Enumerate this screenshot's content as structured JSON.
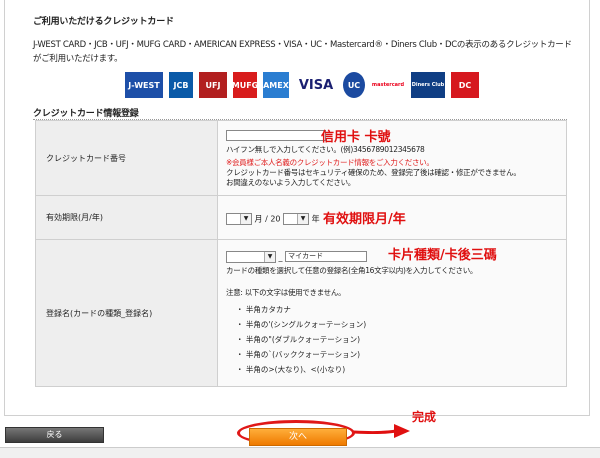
{
  "cards_section": {
    "title": "ご利用いただけるクレジットカード",
    "description": "J-WEST CARD・JCB・UFJ・MUFG CARD・AMERICAN EXPRESS・VISA・UC・Mastercard®・Diners Club・DCの表示のあるクレジットカードがご利用いただけます。",
    "logos": [
      {
        "icon": "jwest-card-logo",
        "text": "J-WEST",
        "color": "#1d4fa8"
      },
      {
        "icon": "jcb-logo",
        "text": "JCB",
        "color": "#0a5aa8"
      },
      {
        "icon": "ufj-card-logo",
        "text": "UFJ",
        "color": "#b21f1f"
      },
      {
        "icon": "mufg-card-logo",
        "text": "MUFG",
        "color": "#d81c1c"
      },
      {
        "icon": "amex-logo",
        "text": "AMEX",
        "color": "#2a7dd1"
      },
      {
        "icon": "visa-logo",
        "text": "VISA",
        "color": "#1a1f71"
      },
      {
        "icon": "uc-logo",
        "text": "UC",
        "color": "#1b4aa0"
      },
      {
        "icon": "mastercard-logo",
        "text": "mastercard",
        "color": "#eb001b"
      },
      {
        "icon": "diners-club-logo",
        "text": "Diners Club",
        "color": "#0f3e84"
      },
      {
        "icon": "dc-card-logo",
        "text": "DC",
        "color": "#d6181f"
      }
    ]
  },
  "registration": {
    "title": "クレジットカード情報登録",
    "card_number": {
      "label": "クレジットカード番号",
      "value": "",
      "hint": "ハイフン無しで入力してください。(例)3456789012345678",
      "warning": "※会員様ご本人名義のクレジットカード情報をご入力ください。",
      "note1": "クレジットカード番号はセキュリティ確保のため、登録完了後は確認・修正ができません。",
      "note2": "お間違えのないよう入力してください。",
      "annotation": "信用卡 卡號"
    },
    "expiry": {
      "label": "有効期限(月/年)",
      "month_value": "",
      "month_unit": "月",
      "sep": "/",
      "year_prefix": "20",
      "year_value": "",
      "year_unit": "年",
      "annotation": "有效期限月/年"
    },
    "reg_name": {
      "label": "登録名(カードの種類_登録名)",
      "type_value": "",
      "underscore": "_",
      "name_value": "マイカード",
      "hint": "カードの種類を選択して任意の登録名(全角16文字以内)を入力してください。",
      "notice_title": "注意: 以下の文字は使用できません。",
      "forbidden": [
        "・ 半角カタカナ",
        "・ 半角の'(シングルクォーテーション)",
        "・ 半角の\"(ダブルクォーテーション)",
        "・ 半角の`(バッククォーテーション)",
        "・ 半角の>(大なり)、<(小なり)"
      ],
      "annotation": "卡片種類/卡後三碼"
    }
  },
  "footer": {
    "back_label": "戻る",
    "next_label": "次へ",
    "annotation": "完成"
  },
  "colors": {
    "annotation": "#e01010",
    "next_button": "#f08a0a",
    "back_button": "#505050"
  }
}
